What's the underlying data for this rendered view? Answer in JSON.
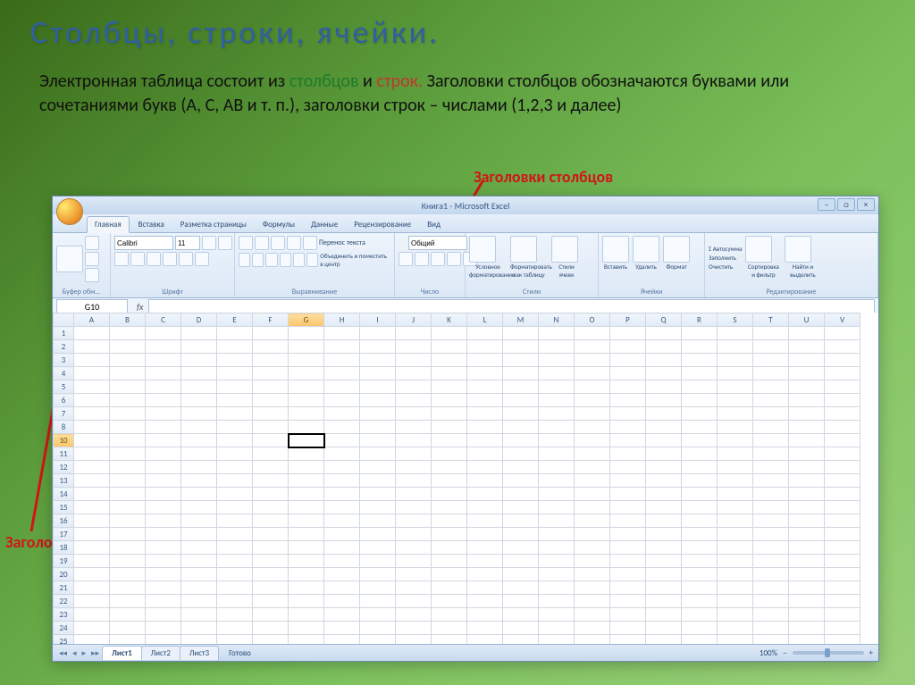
{
  "slide": {
    "title": "Столбцы, строки, ячейки.",
    "para_pre": "Электронная таблица состоит из ",
    "word_cols": "столбцов",
    "para_mid1": " и ",
    "word_rows": "строк.",
    "para_mid2": " Заголовки столбцов обозначаются буквами или сочетаниями букв (A, C, AB и т. п.), заголовки строк – числами (1,2,3 и далее)",
    "label_cols": "Заголовки столбцов",
    "label_rows": "Заголовки строк"
  },
  "excel": {
    "app_title": "Книга1 - Microsoft Excel",
    "tabs": [
      "Главная",
      "Вставка",
      "Разметка страницы",
      "Формулы",
      "Данные",
      "Рецензирование",
      "Вид"
    ],
    "ribbon_groups": [
      "Буфер обм…",
      "Шрифт",
      "Выравнивание",
      "Число",
      "Стили",
      "Ячейки",
      "Редактирование"
    ],
    "font_name": "Calibri",
    "font_size": "11",
    "wrap_text": "Перенос текста",
    "merge_center": "Объединить и поместить в центр",
    "number_format": "Общий",
    "styles": {
      "cond": "Условное форматирование",
      "table": "Форматировать как таблицу",
      "cell": "Стили ячеек"
    },
    "cells": {
      "ins": "Вставить",
      "del": "Удалить",
      "fmt": "Формат"
    },
    "editing": {
      "sum": "Σ Автосумма",
      "fill": "Заполнить",
      "clear": "Очистить",
      "sort": "Сортировка и фильтр",
      "find": "Найти и выделить"
    },
    "name_box": "G10",
    "columns": [
      "A",
      "B",
      "C",
      "D",
      "E",
      "F",
      "G",
      "H",
      "I",
      "J",
      "K",
      "L",
      "M",
      "N",
      "O",
      "P",
      "Q",
      "R",
      "S",
      "T",
      "U",
      "V"
    ],
    "rows": [
      "1",
      "2",
      "3",
      "4",
      "5",
      "6",
      "7",
      "8",
      "10",
      "11",
      "12",
      "13",
      "14",
      "15",
      "16",
      "17",
      "18",
      "19",
      "20",
      "21",
      "22",
      "23",
      "24",
      "25"
    ],
    "selected_col": "G",
    "selected_row": "10",
    "sheets": [
      "Лист1",
      "Лист2",
      "Лист3"
    ],
    "status": "Готово",
    "zoom": "100%"
  }
}
